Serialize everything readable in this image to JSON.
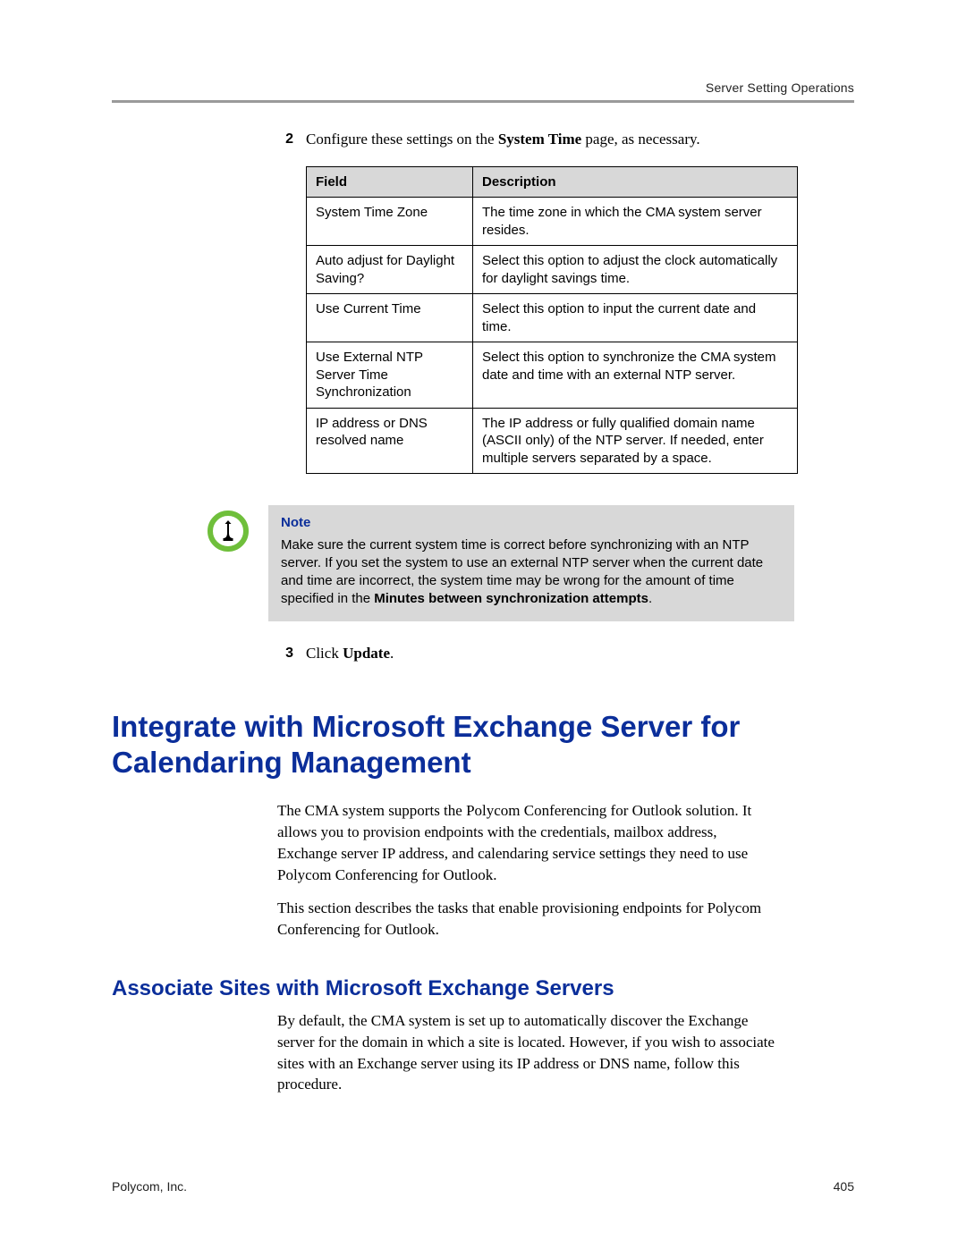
{
  "runningHead": "Server Setting Operations",
  "steps": {
    "s2": {
      "num": "2",
      "pre": "Configure these settings on the ",
      "bold": "System Time",
      "post": " page, as necessary."
    },
    "s3": {
      "num": "3",
      "pre": "Click ",
      "bold": "Update",
      "post": "."
    }
  },
  "table": {
    "headers": {
      "field": "Field",
      "desc": "Description"
    },
    "rows": [
      {
        "field": "System Time Zone",
        "desc": "The time zone in which the CMA system server resides."
      },
      {
        "field": "Auto adjust for Daylight Saving?",
        "desc": "Select this option to adjust the clock automatically for daylight savings time."
      },
      {
        "field": "Use Current Time",
        "desc": "Select this option to input the current date and time."
      },
      {
        "field": "Use External NTP Server Time Synchronization",
        "desc": "Select this option to synchronize the CMA system date and time with an external NTP server."
      },
      {
        "field": "IP address or DNS resolved name",
        "desc": "The IP address or fully qualified domain name (ASCII only) of the NTP server. If needed, enter multiple servers separated by a space."
      }
    ]
  },
  "note": {
    "title": "Note",
    "body_pre": "Make sure the current system time is correct before synchronizing with an NTP server. If you set the system to use an external NTP server when the current date and time are incorrect, the system time may be wrong for the amount of time specified in the ",
    "body_bold": "Minutes between synchronization attempts",
    "body_post": "."
  },
  "h1": "Integrate with Microsoft Exchange Server for Calendaring Management",
  "para1": "The CMA system supports the Polycom Conferencing for Outlook solution. It allows you to provision endpoints with the credentials, mailbox address, Exchange server IP address, and calendaring service settings they need to use Polycom Conferencing for Outlook.",
  "para2": "This section describes the tasks that enable provisioning endpoints for Polycom Conferencing for Outlook.",
  "h2": "Associate Sites with Microsoft Exchange Servers",
  "para3": "By default, the CMA system is set up to automatically discover the Exchange server for the domain in which a site is located. However, if you wish to associate sites with an Exchange server using its IP address or DNS name, follow this procedure.",
  "footer": {
    "left": "Polycom, Inc.",
    "right": "405"
  }
}
